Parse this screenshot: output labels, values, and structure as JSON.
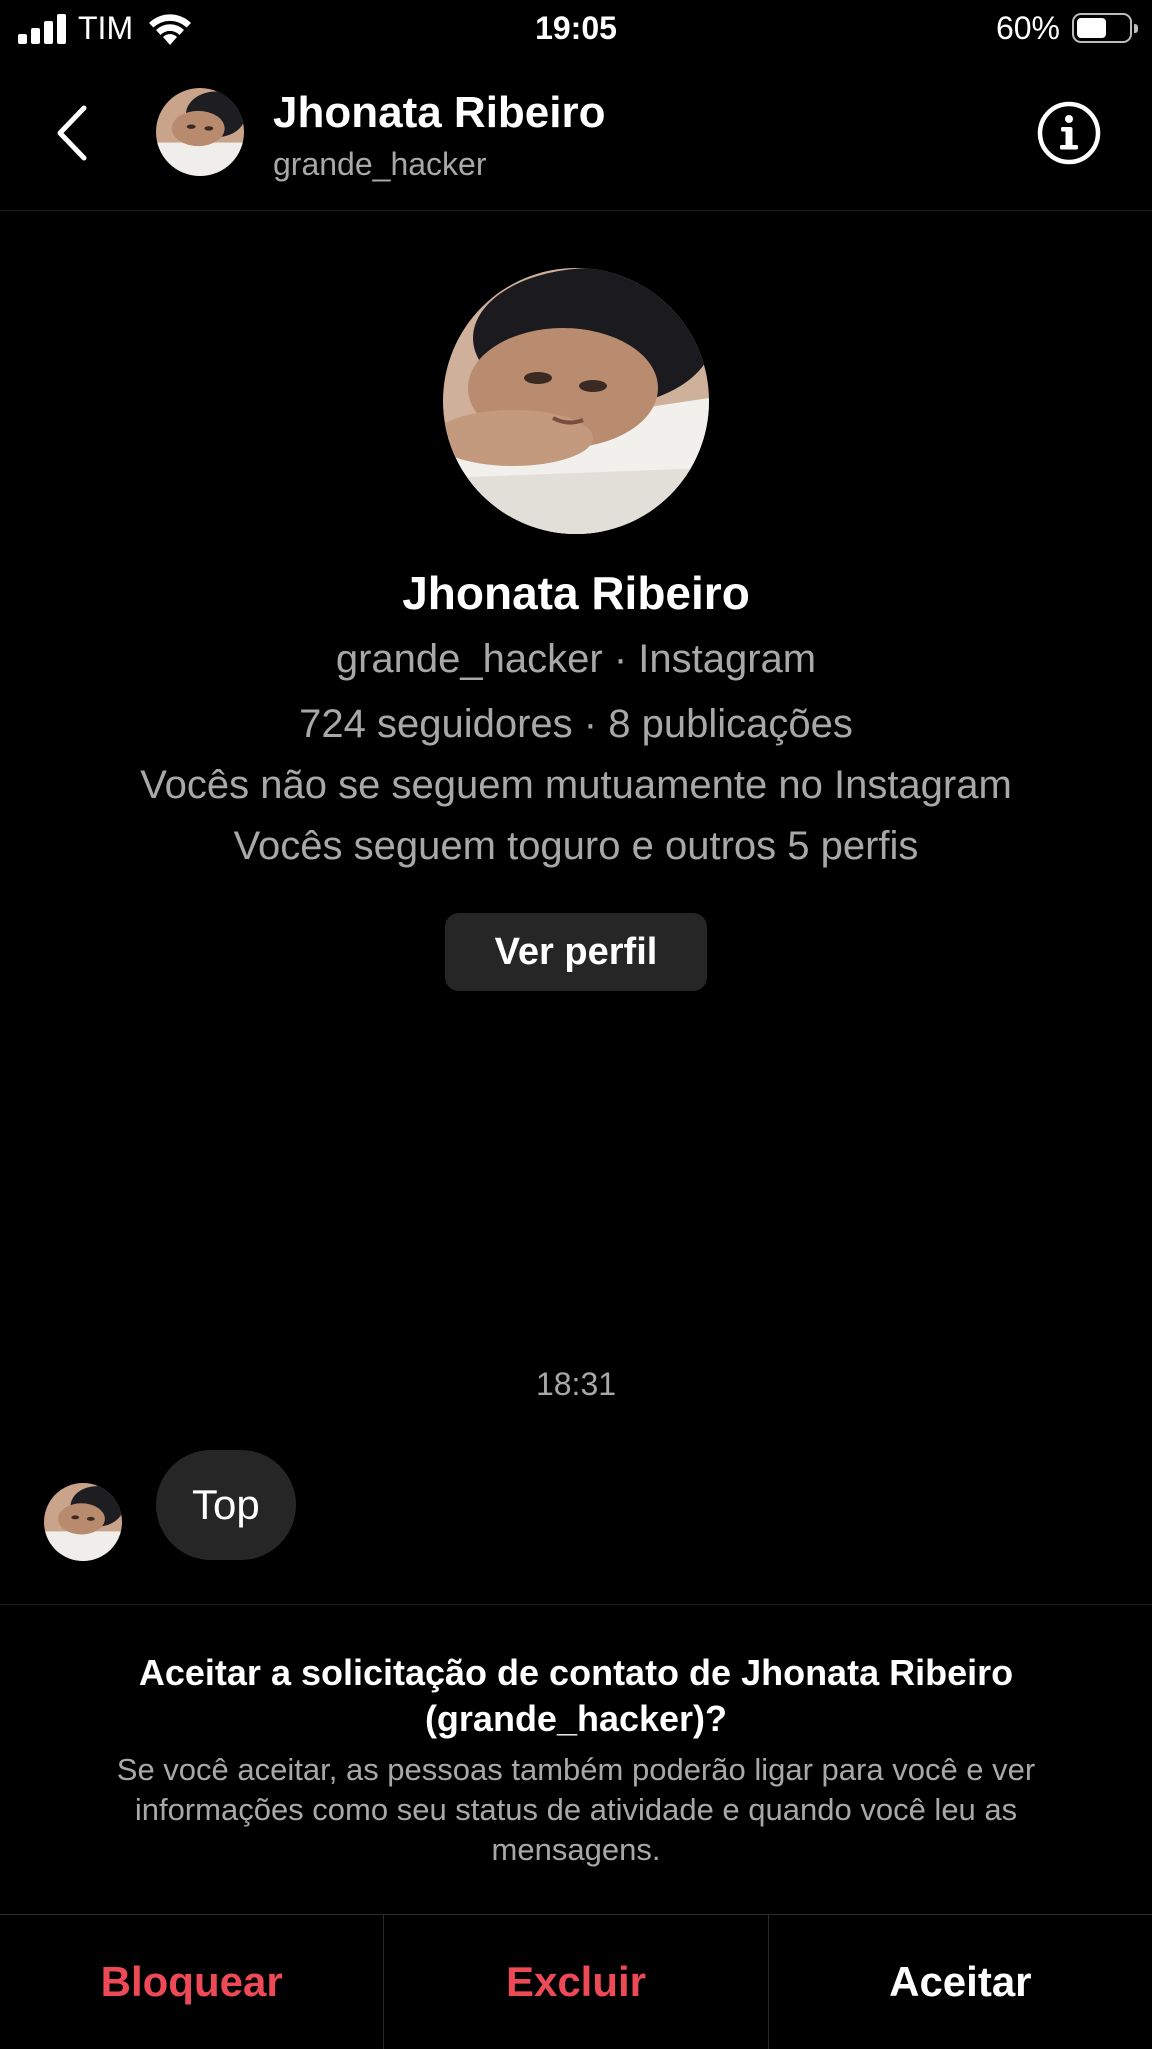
{
  "status_bar": {
    "carrier": "TIM",
    "time": "19:05",
    "battery_percent": "60%",
    "battery_level": 0.6
  },
  "header": {
    "name": "Jhonata Ribeiro",
    "username": "grande_hacker",
    "back_icon": "chevron-left-icon",
    "info_icon": "info-icon"
  },
  "profile": {
    "name": "Jhonata Ribeiro",
    "username_line": "grande_hacker · Instagram",
    "stats_line": "724 seguidores · 8 publicações",
    "mutual_line": "Vocês não se seguem mutuamente no Instagram",
    "follow_line": "Vocês seguem toguro e outros 5 perfis",
    "view_profile_label": "Ver perfil"
  },
  "messages": {
    "timestamp": "18:31",
    "items": [
      {
        "text": "Top"
      }
    ]
  },
  "request": {
    "title": "Aceitar a solicitação de contato de Jhonata Ribeiro (grande_hacker)?",
    "body": "Se você aceitar, as pessoas também poderão ligar para você e ver informações como seu status de atividade e quando você leu as mensagens."
  },
  "actions": {
    "block_label": "Bloquear",
    "delete_label": "Excluir",
    "accept_label": "Aceitar"
  },
  "colors": {
    "background": "#000000",
    "secondary_text": "#a8a8a8",
    "bubble": "#262626",
    "danger": "#ed4956"
  }
}
